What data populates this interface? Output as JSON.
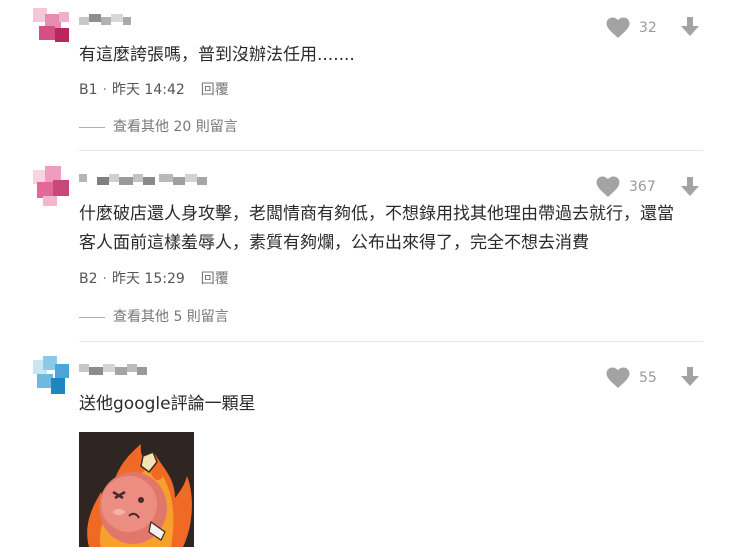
{
  "comments": [
    {
      "content": "有這麼誇張嗎，普到沒辦法任用.......",
      "floor": "B1",
      "time": "昨天 14:42",
      "reply_label": "回覆",
      "thread_label": "查看其他 20 則留言",
      "likes": "32",
      "avatar_colors": [
        "#f4c7d8",
        "#e98bb0",
        "#d44f83",
        "#b8285f"
      ]
    },
    {
      "content_lines": [
        "什麼破店還人身攻擊，老闆情商有夠低，不想錄用找其他理由帶過去就行，還當",
        "客人面前這樣羞辱人，素質有夠爛，公布出來得了，完全不想去消費"
      ],
      "floor": "B2",
      "time": "昨天 15:29",
      "reply_label": "回覆",
      "thread_label": "查看其他 5 則留言",
      "likes": "367",
      "avatar_colors": [
        "#f8d3e1",
        "#ef9dbf",
        "#e2679a",
        "#c9477b"
      ]
    },
    {
      "content": "送他google評論一顆星",
      "likes": "55",
      "avatar_colors": [
        "#c9e6f3",
        "#8cc8e8",
        "#4aa6d8",
        "#1f84c2"
      ]
    }
  ],
  "icons": {
    "like": "heart-icon",
    "downvote": "arrow-down-icon"
  },
  "colors": {
    "icon_gray": "#9e9e9e",
    "divider": "#e6e6e6"
  }
}
